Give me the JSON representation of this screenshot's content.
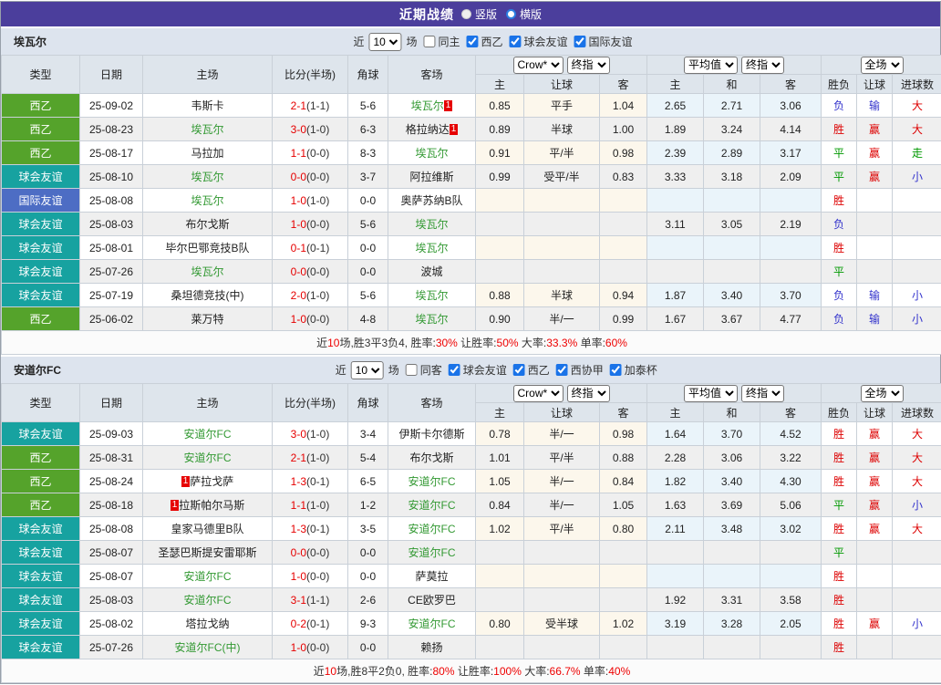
{
  "title_bar": {
    "title": "近期战绩",
    "options": [
      {
        "label": "竖版",
        "selected": true
      },
      {
        "label": "横版",
        "selected": false
      }
    ]
  },
  "colors": {
    "titlebar_purple": "#4b3e9c",
    "section_header_bg": "#dde4ee",
    "table_header_bg": "#dee5ec",
    "team_green": "#339933",
    "score_red": "#e60000",
    "handicap_col_bg": "#fcf7ec",
    "average_col_bg": "#eaf4fa",
    "win_red": "#dd0000",
    "draw_green": "#009900",
    "lose_blue": "#3333cc",
    "checkbox_blue": "#1a73e8"
  },
  "type_colors": {
    "西乙": "#55a32b",
    "球会友谊": "#17a2a0",
    "国际友谊": "#4d6dc4"
  },
  "hdr": {
    "type": "类型",
    "date": "日期",
    "home": "主场",
    "score": "比分(半场)",
    "corner": "角球",
    "away": "客场",
    "dd_company": "Crow*",
    "dd_final1": "终指",
    "dd_avg": "平均值",
    "dd_final2": "终指",
    "dd_scope": "全场",
    "let_home": "主",
    "let_line": "让球",
    "let_away": "客",
    "avg_home": "主",
    "avg_draw": "和",
    "avg_away": "客",
    "result": "胜负",
    "let_result": "让球",
    "goals": "进球数"
  },
  "filter_common": {
    "near": "近",
    "games": "场"
  },
  "sections": [
    {
      "team": "埃瓦尔",
      "filter": {
        "count": "10",
        "same": "同主",
        "comps": [
          "西乙",
          "球会友谊",
          "国际友谊"
        ]
      },
      "rows": [
        {
          "t": "西乙",
          "d": "25-09-02",
          "h": "韦斯卡",
          "hg": 0,
          "s": "2-1",
          "sh": "(1-1)",
          "c": "5-6",
          "a": "埃瓦尔",
          "ag": 1,
          "ac": "1",
          "acp": "a",
          "l": [
            "0.85",
            "平手",
            "1.04"
          ],
          "v": [
            "2.65",
            "2.71",
            "3.06"
          ],
          "r": "负",
          "lr": "输",
          "gl": "大"
        },
        {
          "t": "西乙",
          "d": "25-08-23",
          "h": "埃瓦尔",
          "hg": 1,
          "s": "3-0",
          "sh": "(1-0)",
          "c": "6-3",
          "a": "格拉纳达",
          "ag": 0,
          "ac": "1",
          "acp": "a",
          "l": [
            "0.89",
            "半球",
            "1.00"
          ],
          "v": [
            "1.89",
            "3.24",
            "4.14"
          ],
          "r": "胜",
          "lr": "赢",
          "gl": "大"
        },
        {
          "t": "西乙",
          "d": "25-08-17",
          "h": "马拉加",
          "hg": 0,
          "s": "1-1",
          "sh": "(0-0)",
          "c": "8-3",
          "a": "埃瓦尔",
          "ag": 1,
          "l": [
            "0.91",
            "平/半",
            "0.98"
          ],
          "v": [
            "2.39",
            "2.89",
            "3.17"
          ],
          "r": "平",
          "lr": "赢",
          "gl": "走"
        },
        {
          "t": "球会友谊",
          "d": "25-08-10",
          "h": "埃瓦尔",
          "hg": 1,
          "s": "0-0",
          "sh": "(0-0)",
          "c": "3-7",
          "a": "阿拉维斯",
          "ag": 0,
          "l": [
            "0.99",
            "受平/半",
            "0.83"
          ],
          "v": [
            "3.33",
            "3.18",
            "2.09"
          ],
          "r": "平",
          "lr": "赢",
          "gl": "小"
        },
        {
          "t": "国际友谊",
          "d": "25-08-08",
          "h": "埃瓦尔",
          "hg": 1,
          "s": "1-0",
          "sh": "(1-0)",
          "c": "0-0",
          "a": "奥萨苏纳B队",
          "ag": 0,
          "l": [],
          "v": [],
          "r": "胜",
          "lr": "",
          "gl": ""
        },
        {
          "t": "球会友谊",
          "d": "25-08-03",
          "h": "布尔戈斯",
          "hg": 0,
          "s": "1-0",
          "sh": "(0-0)",
          "c": "5-6",
          "a": "埃瓦尔",
          "ag": 1,
          "l": [],
          "v": [
            "3.11",
            "3.05",
            "2.19"
          ],
          "r": "负",
          "lr": "",
          "gl": ""
        },
        {
          "t": "球会友谊",
          "d": "25-08-01",
          "h": "毕尔巴鄂竞技B队",
          "hg": 0,
          "s": "0-1",
          "sh": "(0-1)",
          "c": "0-0",
          "a": "埃瓦尔",
          "ag": 1,
          "l": [],
          "v": [],
          "r": "胜",
          "lr": "",
          "gl": ""
        },
        {
          "t": "球会友谊",
          "d": "25-07-26",
          "h": "埃瓦尔",
          "hg": 1,
          "s": "0-0",
          "sh": "(0-0)",
          "c": "0-0",
          "a": "波城",
          "ag": 0,
          "l": [],
          "v": [],
          "r": "平",
          "lr": "",
          "gl": ""
        },
        {
          "t": "球会友谊",
          "d": "25-07-19",
          "h": "桑坦德竞技(中)",
          "hg": 0,
          "s": "2-0",
          "sh": "(1-0)",
          "c": "5-6",
          "a": "埃瓦尔",
          "ag": 1,
          "l": [
            "0.88",
            "半球",
            "0.94"
          ],
          "v": [
            "1.87",
            "3.40",
            "3.70"
          ],
          "r": "负",
          "lr": "输",
          "gl": "小"
        },
        {
          "t": "西乙",
          "d": "25-06-02",
          "h": "莱万特",
          "hg": 0,
          "s": "1-0",
          "sh": "(0-0)",
          "c": "4-8",
          "a": "埃瓦尔",
          "ag": 1,
          "l": [
            "0.90",
            "半/一",
            "0.99"
          ],
          "v": [
            "1.67",
            "3.67",
            "4.77"
          ],
          "r": "负",
          "lr": "输",
          "gl": "小"
        }
      ],
      "summary": [
        {
          "t": "近",
          "r": 0
        },
        {
          "t": "10",
          "r": 1
        },
        {
          "t": "场,胜3平3负4, 胜率:",
          "r": 0
        },
        {
          "t": "30%",
          "r": 1
        },
        {
          "t": " 让胜率:",
          "r": 0
        },
        {
          "t": "50%",
          "r": 1
        },
        {
          "t": " 大率:",
          "r": 0
        },
        {
          "t": "33.3%",
          "r": 1
        },
        {
          "t": " 单率:",
          "r": 0
        },
        {
          "t": "60%",
          "r": 1
        }
      ]
    },
    {
      "team": "安道尔FC",
      "filter": {
        "count": "10",
        "same": "同客",
        "comps": [
          "球会友谊",
          "西乙",
          "西协甲",
          "加泰杯"
        ]
      },
      "rows": [
        {
          "t": "球会友谊",
          "d": "25-09-03",
          "h": "安道尔FC",
          "hg": 1,
          "s": "3-0",
          "sh": "(1-0)",
          "c": "3-4",
          "a": "伊斯卡尔德斯",
          "ag": 0,
          "l": [
            "0.78",
            "半/一",
            "0.98"
          ],
          "v": [
            "1.64",
            "3.70",
            "4.52"
          ],
          "r": "胜",
          "lr": "赢",
          "gl": "大"
        },
        {
          "t": "西乙",
          "d": "25-08-31",
          "h": "安道尔FC",
          "hg": 1,
          "s": "2-1",
          "sh": "(1-0)",
          "c": "5-4",
          "a": "布尔戈斯",
          "ag": 0,
          "l": [
            "1.01",
            "平/半",
            "0.88"
          ],
          "v": [
            "2.28",
            "3.06",
            "3.22"
          ],
          "r": "胜",
          "lr": "赢",
          "gl": "大"
        },
        {
          "t": "西乙",
          "d": "25-08-24",
          "h": "萨拉戈萨",
          "hg": 0,
          "hc": "1",
          "hcp": "b",
          "s": "1-3",
          "sh": "(0-1)",
          "c": "6-5",
          "a": "安道尔FC",
          "ag": 1,
          "l": [
            "1.05",
            "半/一",
            "0.84"
          ],
          "v": [
            "1.82",
            "3.40",
            "4.30"
          ],
          "r": "胜",
          "lr": "赢",
          "gl": "大"
        },
        {
          "t": "西乙",
          "d": "25-08-18",
          "h": "拉斯帕尔马斯",
          "hg": 0,
          "hc": "1",
          "hcp": "b",
          "s": "1-1",
          "sh": "(1-0)",
          "c": "1-2",
          "a": "安道尔FC",
          "ag": 1,
          "l": [
            "0.84",
            "半/一",
            "1.05"
          ],
          "v": [
            "1.63",
            "3.69",
            "5.06"
          ],
          "r": "平",
          "lr": "赢",
          "gl": "小"
        },
        {
          "t": "球会友谊",
          "d": "25-08-08",
          "h": "皇家马德里B队",
          "hg": 0,
          "s": "1-3",
          "sh": "(0-1)",
          "c": "3-5",
          "a": "安道尔FC",
          "ag": 1,
          "l": [
            "1.02",
            "平/半",
            "0.80"
          ],
          "v": [
            "2.11",
            "3.48",
            "3.02"
          ],
          "r": "胜",
          "lr": "赢",
          "gl": "大"
        },
        {
          "t": "球会友谊",
          "d": "25-08-07",
          "h": "圣瑟巴斯提安雷耶斯",
          "hg": 0,
          "s": "0-0",
          "sh": "(0-0)",
          "c": "0-0",
          "a": "安道尔FC",
          "ag": 1,
          "l": [],
          "v": [],
          "r": "平",
          "lr": "",
          "gl": ""
        },
        {
          "t": "球会友谊",
          "d": "25-08-07",
          "h": "安道尔FC",
          "hg": 1,
          "s": "1-0",
          "sh": "(0-0)",
          "c": "0-0",
          "a": "萨莫拉",
          "ag": 0,
          "l": [],
          "v": [],
          "r": "胜",
          "lr": "",
          "gl": ""
        },
        {
          "t": "球会友谊",
          "d": "25-08-03",
          "h": "安道尔FC",
          "hg": 1,
          "s": "3-1",
          "sh": "(1-1)",
          "c": "2-6",
          "a": "CE欧罗巴",
          "ag": 0,
          "l": [],
          "v": [
            "1.92",
            "3.31",
            "3.58"
          ],
          "r": "胜",
          "lr": "",
          "gl": ""
        },
        {
          "t": "球会友谊",
          "d": "25-08-02",
          "h": "塔拉戈纳",
          "hg": 0,
          "s": "0-2",
          "sh": "(0-1)",
          "c": "9-3",
          "a": "安道尔FC",
          "ag": 1,
          "l": [
            "0.80",
            "受半球",
            "1.02"
          ],
          "v": [
            "3.19",
            "3.28",
            "2.05"
          ],
          "r": "胜",
          "lr": "赢",
          "gl": "小"
        },
        {
          "t": "球会友谊",
          "d": "25-07-26",
          "h": "安道尔FC(中)",
          "hg": 1,
          "s": "1-0",
          "sh": "(0-0)",
          "c": "0-0",
          "a": "赖扬",
          "ag": 0,
          "l": [],
          "v": [],
          "r": "胜",
          "lr": "",
          "gl": ""
        }
      ],
      "summary": [
        {
          "t": "近",
          "r": 0
        },
        {
          "t": "10",
          "r": 1
        },
        {
          "t": "场,胜8平2负0, 胜率:",
          "r": 0
        },
        {
          "t": "80%",
          "r": 1
        },
        {
          "t": " 让胜率:",
          "r": 0
        },
        {
          "t": "100%",
          "r": 1
        },
        {
          "t": " 大率:",
          "r": 0
        },
        {
          "t": "66.7%",
          "r": 1
        },
        {
          "t": " 单率:",
          "r": 0
        },
        {
          "t": "40%",
          "r": 1
        }
      ]
    }
  ]
}
